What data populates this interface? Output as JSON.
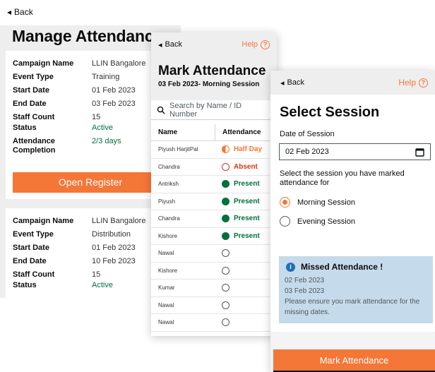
{
  "screen1": {
    "back_label": "Back",
    "title": "Manage Attendance",
    "card1": {
      "rows": [
        {
          "k": "Campaign Name",
          "v": "LLIN Bangalore"
        },
        {
          "k": "Event Type",
          "v": "Training"
        },
        {
          "k": "Start Date",
          "v": "01 Feb 2023"
        },
        {
          "k": "End Date",
          "v": "03 Feb 2023"
        },
        {
          "k": "Staff Count",
          "v": "15"
        },
        {
          "k": "Status",
          "v": "Active"
        },
        {
          "k": "Attendance Completion",
          "v": "2/3 days"
        }
      ],
      "button_label": "Open Register"
    },
    "card2": {
      "rows": [
        {
          "k": "Campaign Name",
          "v": "LLIN Bangalore"
        },
        {
          "k": "Event Type",
          "v": "Distribution"
        },
        {
          "k": "Start Date",
          "v": "01 Feb 2023"
        },
        {
          "k": "End Date",
          "v": "10 Feb 2023"
        },
        {
          "k": "Staff Count",
          "v": "15"
        },
        {
          "k": "Status",
          "v": "Active"
        }
      ]
    }
  },
  "screen2": {
    "back_label": "Back",
    "help_label": "Help",
    "title": "Mark Attendance",
    "subtitle": "03 Feb 2023- Morning Session",
    "search_placeholder": "Search by Name / ID Number",
    "col_name": "Name",
    "col_attendance": "Attendance",
    "rows": [
      {
        "name": "Piyush HarjitPal",
        "status": "Half Day",
        "kind": "half"
      },
      {
        "name": "Chandra",
        "status": "Absent",
        "kind": "absent"
      },
      {
        "name": "Antriksh",
        "status": "Present",
        "kind": "present"
      },
      {
        "name": "Piyush",
        "status": "Present",
        "kind": "present"
      },
      {
        "name": "Chandra",
        "status": "Present",
        "kind": "present"
      },
      {
        "name": "Kishore",
        "status": "Present",
        "kind": "present"
      },
      {
        "name": "Nawal",
        "status": "",
        "kind": "none"
      },
      {
        "name": "Kishore",
        "status": "",
        "kind": "none"
      },
      {
        "name": "Kumar",
        "status": "",
        "kind": "none"
      },
      {
        "name": "Nawal",
        "status": "",
        "kind": "none"
      },
      {
        "name": "Nawal",
        "status": "",
        "kind": "none"
      }
    ]
  },
  "screen3": {
    "back_label": "Back",
    "help_label": "Help",
    "title": "Select Session",
    "date_label": "Date of Session",
    "date_value": "02 Feb 2023",
    "session_prompt": "Select the session you have marked attendance for",
    "sessions": [
      {
        "label": "Morning Session",
        "selected": true
      },
      {
        "label": "Evening Session",
        "selected": false
      }
    ],
    "missed": {
      "heading": "Missed Attendance !",
      "dates": [
        "02 Feb 2023",
        "03 Feb 2023"
      ],
      "note": "Please ensure you mark attendance for the missing dates."
    },
    "button_label": "Mark Attendance"
  },
  "colors": {
    "accent": "#f47738",
    "present": "#00703c",
    "absent": "#d4351c",
    "info_bg": "#c5daea",
    "info_icon": "#1d70b8"
  }
}
